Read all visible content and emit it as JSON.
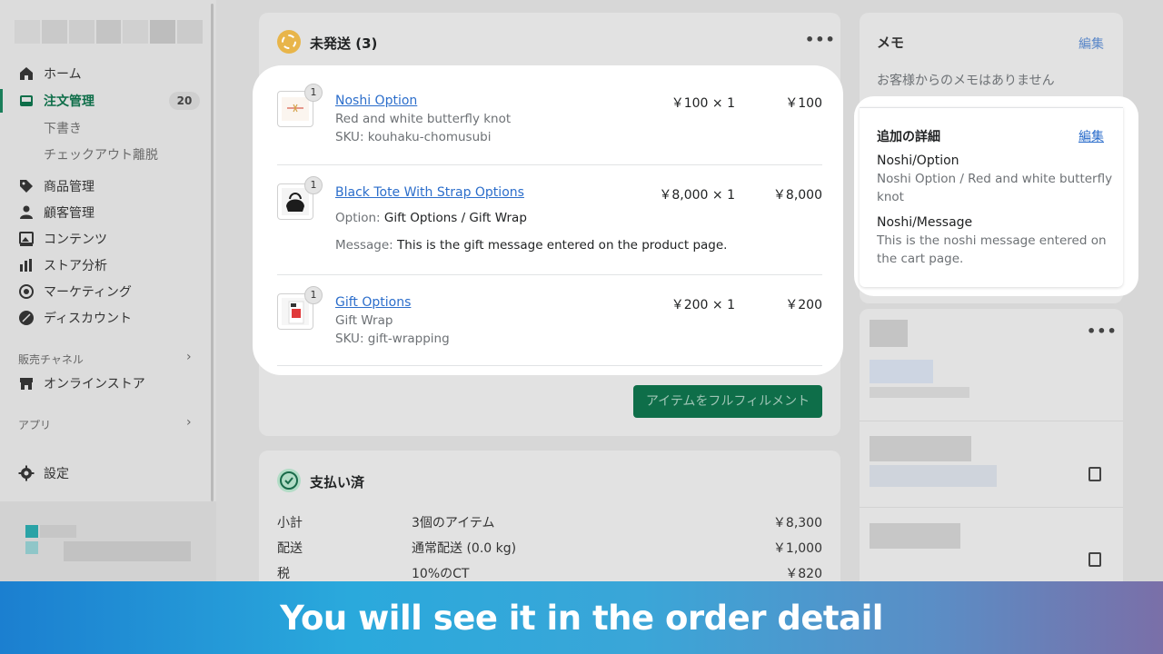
{
  "sidebar": {
    "home": "ホーム",
    "orders": "注文管理",
    "orders_count": "20",
    "drafts": "下書き",
    "abandoned": "チェックアウト離脱",
    "products": "商品管理",
    "customers": "顧客管理",
    "content": "コンテンツ",
    "analytics": "ストア分析",
    "marketing": "マーケティング",
    "discounts": "ディスカウント",
    "sales_channels": "販売チャネル",
    "online_store": "オンラインストア",
    "apps": "アプリ",
    "settings": "設定"
  },
  "unfulfilled": {
    "title": "未発送 (3)",
    "items": [
      {
        "qty": "1",
        "title": "Noshi Option",
        "line1": "Red and white butterfly knot",
        "line2": "SKU: kouhaku-chomusubi",
        "price": "￥100 × 1",
        "total": "￥100"
      },
      {
        "qty": "1",
        "title": "Black Tote With Strap Options",
        "option_label": "Option:",
        "option_value": "Gift Options / Gift Wrap",
        "message_label": "Message:",
        "message_value": "This is the gift message entered on the product page.",
        "price": "￥8,000 × 1",
        "total": "￥8,000"
      },
      {
        "qty": "1",
        "title": "Gift Options",
        "line1": "Gift Wrap",
        "line2": "SKU: gift-wrapping",
        "price": "￥200 × 1",
        "total": "￥200"
      }
    ],
    "fulfill_button": "アイテムをフルフィルメント"
  },
  "payment": {
    "title": "支払い済",
    "rows": [
      {
        "label": "小計",
        "desc": "3個のアイテム",
        "amount": "￥8,300"
      },
      {
        "label": "配送",
        "desc": "通常配送 (0.0 kg)",
        "amount": "￥1,000"
      },
      {
        "label": "税",
        "desc": "10%のCT",
        "amount": "￥820"
      }
    ]
  },
  "memo": {
    "title": "メモ",
    "edit": "編集",
    "empty": "お客様からのメモはありません"
  },
  "details": {
    "title": "追加の詳細",
    "edit": "編集",
    "fields": [
      {
        "key": "Noshi/Option",
        "value": "Noshi Option / Red and white butterfly knot"
      },
      {
        "key": "Noshi/Message",
        "value": "This is the noshi message entered on the cart page."
      }
    ]
  },
  "banner": "You will see it in the order detail",
  "colors": {
    "accent": "#0e6e49",
    "link": "#2c6ecb",
    "banner_start": "#1b7fd0",
    "banner_end": "#7a6fa8"
  }
}
